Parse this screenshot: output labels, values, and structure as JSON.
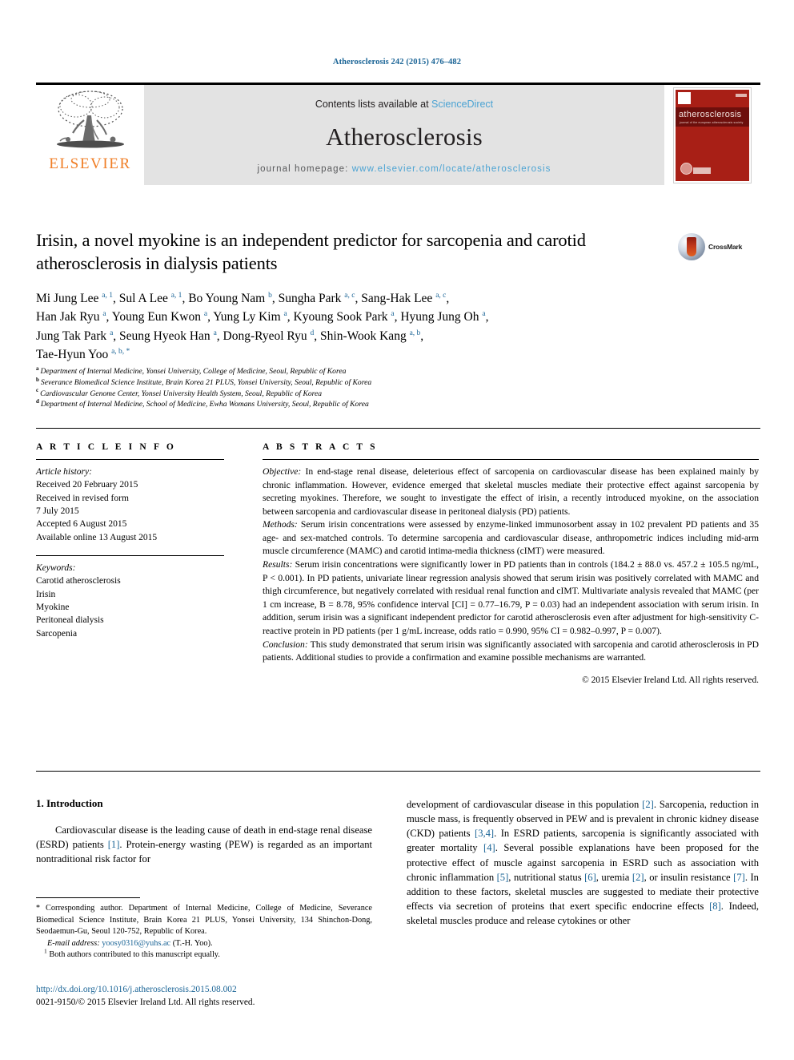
{
  "running_head": "Atherosclerosis 242 (2015) 476–482",
  "masthead": {
    "publisher_wordmark": "ELSEVIER",
    "contents_prefix": "Contents lists available at ",
    "contents_link": "ScienceDirect",
    "journal_name": "Atherosclerosis",
    "homepage_prefix": "journal homepage: ",
    "homepage_url": "www.elsevier.com/locate/atherosclerosis",
    "cover": {
      "title": "atherosclerosis",
      "subtitle": "journal of the european atherosclerosis society"
    }
  },
  "article": {
    "title": "Irisin, a novel myokine is an independent predictor for sarcopenia and carotid atherosclerosis in dialysis patients",
    "crossmark_label": "CrossMark",
    "authors_html": "Mi Jung Lee <sup>a, 1</sup>, Sul A Lee <sup>a, 1</sup>, Bo Young Nam <sup>b</sup>, Sungha Park <sup>a, c</sup>, Sang-Hak Lee <sup>a, c</sup>,<br>Han Jak Ryu <sup>a</sup>, Young Eun Kwon <sup>a</sup>, Yung Ly Kim <sup>a</sup>, Kyoung Sook Park <sup>a</sup>, Hyung Jung Oh <sup>a</sup>,<br>Jung Tak Park <sup>a</sup>, Seung Hyeok Han <sup>a</sup>, Dong-Ryeol Ryu <sup>d</sup>, Shin-Wook Kang <sup>a, b</sup>,<br>Tae-Hyun Yoo <sup>a, b, *</sup>",
    "affiliations": [
      {
        "marker": "a",
        "text": "Department of Internal Medicine, Yonsei University, College of Medicine, Seoul, Republic of Korea"
      },
      {
        "marker": "b",
        "text": "Severance Biomedical Science Institute, Brain Korea 21 PLUS, Yonsei University, Seoul, Republic of Korea"
      },
      {
        "marker": "c",
        "text": "Cardiovascular Genome Center, Yonsei University Health System, Seoul, Republic of Korea"
      },
      {
        "marker": "d",
        "text": "Department of Internal Medicine, School of Medicine, Ewha Womans University, Seoul, Republic of Korea"
      }
    ]
  },
  "article_info": {
    "heading": "A R T I C L E   I N F O",
    "history_label": "Article history:",
    "history": [
      "Received 20 February 2015",
      "Received in revised form",
      "7 July 2015",
      "Accepted 6 August 2015",
      "Available online 13 August 2015"
    ],
    "keywords_label": "Keywords:",
    "keywords": [
      "Carotid atherosclerosis",
      "Irisin",
      "Myokine",
      "Peritoneal dialysis",
      "Sarcopenia"
    ]
  },
  "abstract": {
    "heading": "A B S T R A C T S",
    "sections": [
      {
        "label": "Objective:",
        "text": " In end-stage renal disease, deleterious effect of sarcopenia on cardiovascular disease has been explained mainly by chronic inflammation. However, evidence emerged that skeletal muscles mediate their protective effect against sarcopenia by secreting myokines. Therefore, we sought to investigate the effect of irisin, a recently introduced myokine, on the association between sarcopenia and cardiovascular disease in peritoneal dialysis (PD) patients."
      },
      {
        "label": "Methods:",
        "text": " Serum irisin concentrations were assessed by enzyme-linked immunosorbent assay in 102 prevalent PD patients and 35 age- and sex-matched controls. To determine sarcopenia and cardiovascular disease, anthropometric indices including mid-arm muscle circumference (MAMC) and carotid intima-media thickness (cIMT) were measured."
      },
      {
        "label": "Results:",
        "text": " Serum irisin concentrations were significantly lower in PD patients than in controls (184.2 ± 88.0 vs. 457.2 ± 105.5 ng/mL, P < 0.001). In PD patients, univariate linear regression analysis showed that serum irisin was positively correlated with MAMC and thigh circumference, but negatively correlated with residual renal function and cIMT. Multivariate analysis revealed that MAMC (per 1 cm increase, B = 8.78, 95% confidence interval [CI] = 0.77–16.79, P = 0.03) had an independent association with serum irisin. In addition, serum irisin was a significant independent predictor for carotid atherosclerosis even after adjustment for high-sensitivity C-reactive protein in PD patients (per 1 g/mL increase, odds ratio = 0.990, 95% CI = 0.982–0.997, P = 0.007)."
      },
      {
        "label": "Conclusion:",
        "text": " This study demonstrated that serum irisin was significantly associated with sarcopenia and carotid atherosclerosis in PD patients. Additional studies to provide a confirmation and examine possible mechanisms are warranted."
      }
    ],
    "copyright": "© 2015 Elsevier Ireland Ltd. All rights reserved."
  },
  "body": {
    "section_heading": "1.  Introduction",
    "left_paragraph_html": "Cardiovascular disease is the leading cause of death in end-stage renal disease (ESRD) patients <span class=\"ref\">[1]</span>. Protein-energy wasting (PEW) is regarded as an important nontraditional risk factor for",
    "right_paragraph_html": "development of cardiovascular disease in this population <span class=\"ref\">[2]</span>. Sarcopenia, reduction in muscle mass, is frequently observed in PEW and is prevalent in chronic kidney disease (CKD) patients <span class=\"ref\">[3,4]</span>. In ESRD patients, sarcopenia is significantly associated with greater mortality <span class=\"ref\">[4]</span>. Several possible explanations have been proposed for the protective effect of muscle against sarcopenia in ESRD such as association with chronic inflammation <span class=\"ref\">[5]</span>, nutritional status <span class=\"ref\">[6]</span>, uremia <span class=\"ref\">[2]</span>, or insulin resistance <span class=\"ref\">[7]</span>. In addition to these factors, skeletal muscles are suggested to mediate their protective effects via secretion of proteins that exert specific endocrine effects <span class=\"ref\">[8]</span>. Indeed, skeletal muscles produce and release cytokines or other"
  },
  "footnotes": {
    "corresponding_html": "<span class=\"fn-star\">*</span> Corresponding author. Department of Internal Medicine, College of Medicine, Severance Biomedical Science Institute, Brain Korea 21 PLUS, Yonsei University, 134 Shinchon-Dong, Seodaemun-Gu, Seoul 120-752, Republic of Korea.",
    "email_label": "E-mail address:",
    "email": "yoosy0316@yuhs.ac",
    "email_suffix": "(T.-H. Yoo).",
    "equal_contrib_html": "<sup>1</sup>  Both authors contributed to this manuscript equally."
  },
  "footer": {
    "doi": "http://dx.doi.org/10.1016/j.atherosclerosis.2015.08.002",
    "issn_line": "0021-9150/© 2015 Elsevier Ireland Ltd. All rights reserved."
  },
  "colors": {
    "link": "#1a6496",
    "sciencedirect": "#4ba3d3",
    "elsevier_orange": "#f07e26",
    "masthead_gray": "#e3e3e3",
    "cover_red": "#a81f16"
  }
}
